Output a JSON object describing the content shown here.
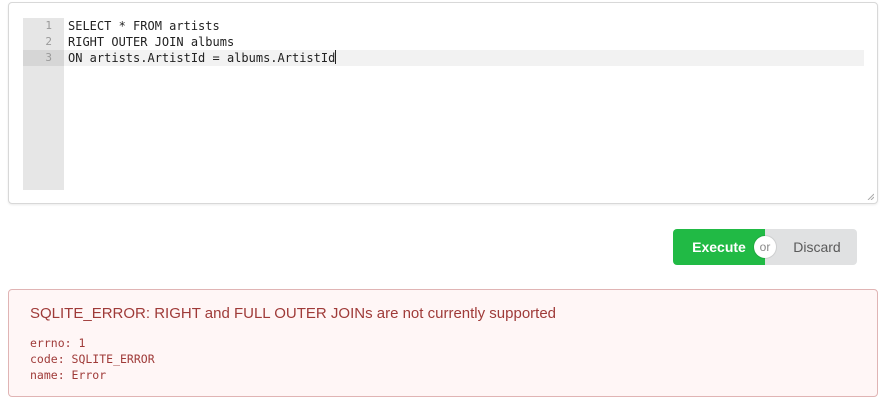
{
  "editor": {
    "lines": [
      {
        "number": "1",
        "text": "SELECT * FROM artists"
      },
      {
        "number": "2",
        "text": "RIGHT OUTER JOIN albums"
      },
      {
        "number": "3",
        "text": "ON artists.ArtistId = albums.ArtistId"
      }
    ],
    "active_line": 3
  },
  "actions": {
    "execute_label": "Execute",
    "or_label": "or",
    "discard_label": "Discard"
  },
  "error": {
    "title": "SQLITE_ERROR: RIGHT and FULL OUTER JOINs are not currently supported",
    "details": [
      "errno: 1",
      "code: SQLITE_ERROR",
      "name: Error"
    ]
  },
  "colors": {
    "execute": "#21ba45",
    "discard": "#e0e1e2",
    "error_text": "#9f3a38",
    "error_bg": "#fff6f6"
  },
  "icons": {
    "resize": "resize-grip-icon"
  }
}
